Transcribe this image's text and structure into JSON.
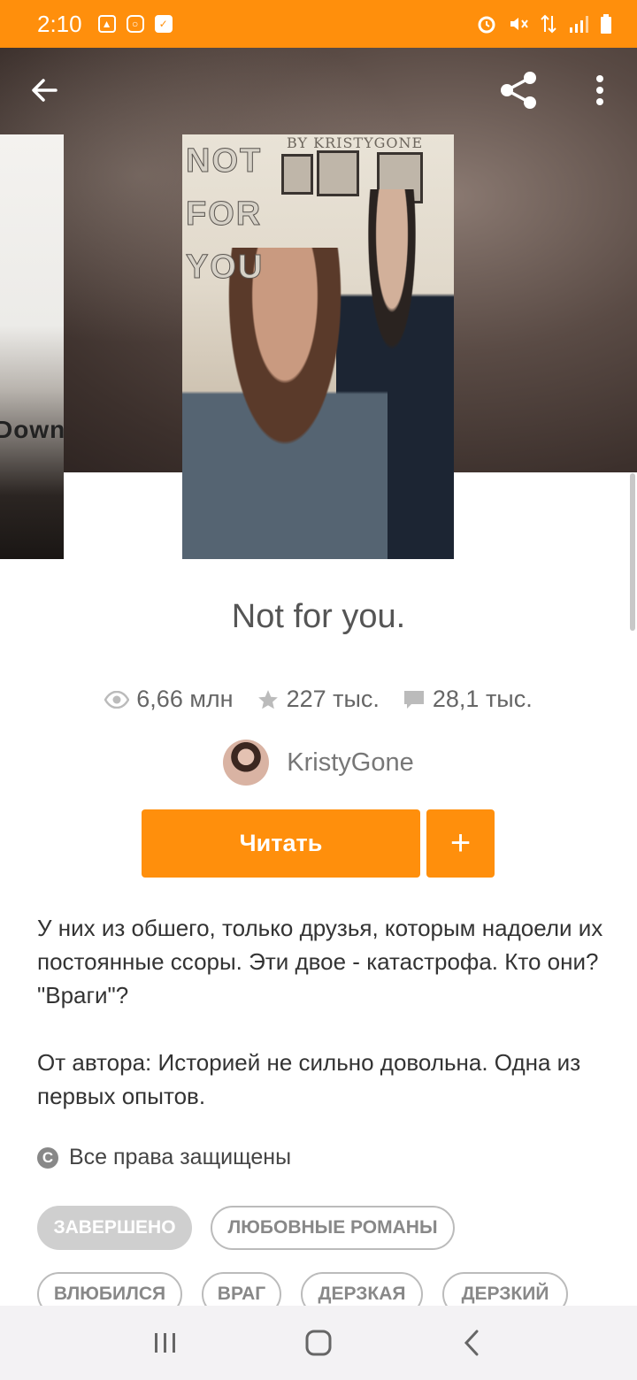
{
  "status_bar": {
    "time": "2:10",
    "left_icons": [
      "gallery-icon",
      "instagram-icon",
      "check-icon"
    ],
    "right_icons": [
      "alarm-icon",
      "mute-icon",
      "data-icon",
      "signal-icon",
      "battery-icon"
    ],
    "color": "#ff8f0c"
  },
  "toolbar": {
    "back_icon": "arrow-left-icon",
    "share_icon": "share-icon",
    "more_icon": "more-vertical-icon"
  },
  "covers": {
    "left_partial_text": "Down",
    "main": {
      "title_lines": [
        "NOT",
        "FOR",
        "YOU"
      ],
      "byline": "BY KRISTYGONE"
    }
  },
  "book": {
    "title": "Not for you.",
    "stats": {
      "reads": "6,66 млн",
      "votes": "227 тыс.",
      "comments": "28,1 тыс."
    },
    "author": "KristyGone"
  },
  "actions": {
    "read_label": "Читать",
    "add_label": "+",
    "accent": "#ff8f0c"
  },
  "description": {
    "paragraph1": "У них из обшего, только друзья, которым надоели их постоянные ссоры. Эти двое - катастрофа. Кто они? \"Враги\"?",
    "paragraph2": "От автора: Историей не сильно довольна. Одна из первых опытов."
  },
  "rights": {
    "text": "Все права защищены"
  },
  "tags": [
    "ЗАВЕРШЕНО",
    "ЛЮБОВНЫЕ РОМАНЫ",
    "ВЛЮБИЛСЯ",
    "ВРАГ",
    "ДЕРЗКАЯ",
    "ДЕРЗКИЙ"
  ],
  "navbar": {
    "items": [
      "recent-apps-icon",
      "home-icon",
      "back-icon"
    ]
  }
}
